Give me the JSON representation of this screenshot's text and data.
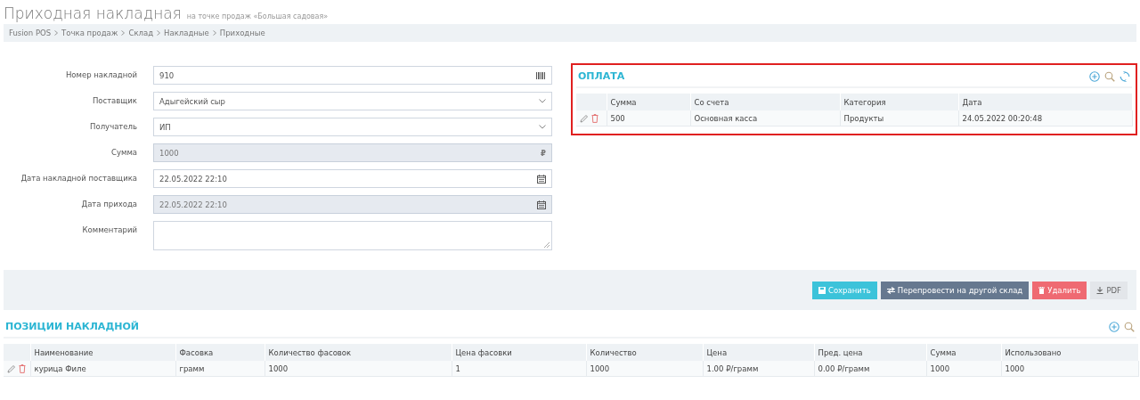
{
  "page_title": "Приходная накладная",
  "page_subtitle": "на точке продаж «Большая садовая»",
  "breadcrumbs": [
    "Fusion POS",
    "Точка продаж",
    "Склад",
    "Накладные",
    "Приходные"
  ],
  "form": [
    {
      "label": "Номер накладной",
      "kind": "barcode",
      "value": "910",
      "disabled": false
    },
    {
      "label": "Поставщик",
      "kind": "select",
      "value": "Адыгейский сыр",
      "disabled": false
    },
    {
      "label": "Получатель",
      "kind": "select",
      "value": "ИП",
      "disabled": false
    },
    {
      "label": "Сумма",
      "kind": "currency",
      "value": "1000",
      "suffix": "₽",
      "disabled": true
    },
    {
      "label": "Дата накладной поставщика",
      "kind": "date",
      "value": "22.05.2022 22:10",
      "disabled": false
    },
    {
      "label": "Дата прихода",
      "kind": "date",
      "value": "22.05.2022 22:10",
      "disabled": true
    },
    {
      "label": "Комментарий",
      "kind": "textarea",
      "disabled": false
    }
  ],
  "payment": {
    "title": "ОПЛАТА",
    "highlighted": true,
    "columns": [
      "Сумма",
      "Со счета",
      "Категория",
      "Дата"
    ],
    "rows": [
      [
        "500",
        "Основная касса",
        "Продукты",
        "24.05.2022 00:20:48"
      ]
    ]
  },
  "actions": [
    {
      "kind": "save",
      "label": "Сохранить"
    },
    {
      "kind": "transfer",
      "label": "Перепровести на другой склад"
    },
    {
      "kind": "delete",
      "label": "Удалить"
    },
    {
      "kind": "pdf",
      "label": "PDF"
    }
  ],
  "positions": {
    "title": "ПОЗИЦИИ НАКЛАДНОЙ",
    "columns": [
      "Наименование",
      "Фасовка",
      "Количество фасовок",
      "Цена фасовки",
      "Количество",
      "Цена",
      "Пред. цена",
      "Сумма",
      "Использовано"
    ],
    "rows": [
      [
        "курица Филе",
        "грамм",
        "1000",
        "1",
        "1000",
        "1.00 ₽/грамм",
        "0.00 ₽/грамм",
        "1000",
        "1000"
      ]
    ]
  }
}
